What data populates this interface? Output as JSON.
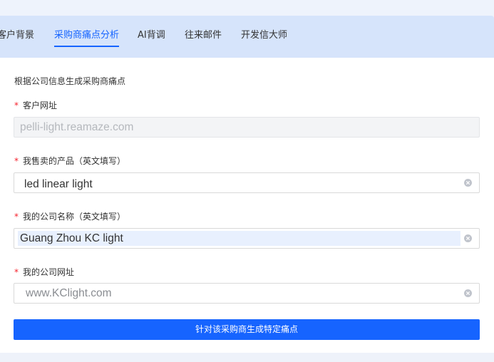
{
  "tabs": [
    {
      "label": "客户背景",
      "active": false
    },
    {
      "label": "采购商痛点分析",
      "active": true
    },
    {
      "label": "AI背调",
      "active": false
    },
    {
      "label": "往来邮件",
      "active": false
    },
    {
      "label": "开发信大师",
      "active": false
    }
  ],
  "form": {
    "section_title": "根据公司信息生成采购商痛点",
    "required_mark": "*",
    "fields": [
      {
        "label": "客户网址",
        "value": "pelli-light.reamaze.com",
        "disabled": true
      },
      {
        "label": "我售卖的产品（英文填写）",
        "value": "led linear light",
        "clearable": true
      },
      {
        "label": "我的公司名称（英文填写）",
        "value": "Guang Zhou KC light",
        "clearable": true,
        "autofilled": true
      },
      {
        "label": "我的公司网址",
        "value": "www.KClight.com",
        "clearable": true
      }
    ],
    "submit_label": "针对该采购商生成特定痛点"
  },
  "icons": {
    "clear": "clear-circle-icon"
  },
  "colors": {
    "primary": "#1664ff",
    "tab_bar": "#d6e4fb",
    "required": "#f5222d",
    "autofill_highlight": "#e8f0fe"
  }
}
